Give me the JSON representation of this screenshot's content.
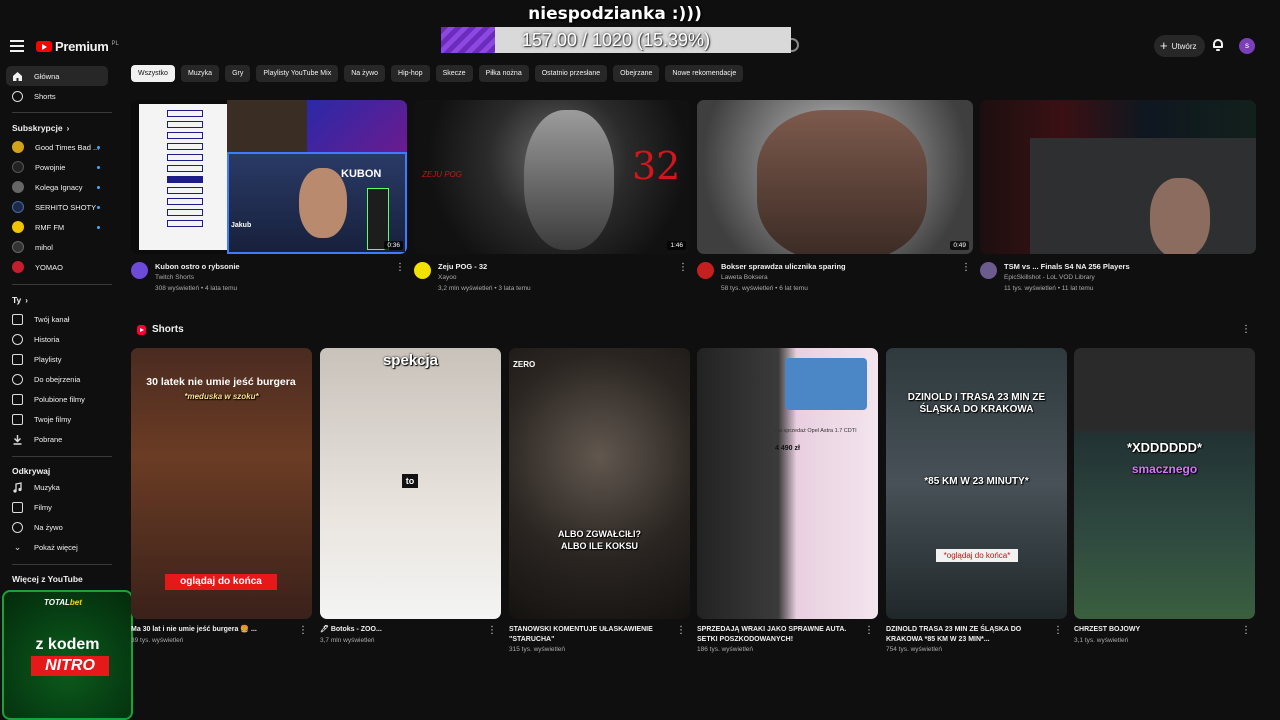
{
  "overlay": {
    "title": "niespodzianka :)))",
    "progress_text": "157.00 / 1020 (15.39%)",
    "progress_fraction": 0.1539
  },
  "header": {
    "logo_text": "Premium",
    "logo_sup": "PL",
    "create_label": "Utwórz",
    "avatar_letter": "s"
  },
  "sidebar": {
    "main": [
      {
        "label": "Główna"
      },
      {
        "label": "Shorts"
      }
    ],
    "subscriptions_heading": "Subskrypcje",
    "subscriptions": [
      {
        "label": "Good Times Bad ...",
        "color": "#d4a21a"
      },
      {
        "label": "Powojnie",
        "color": "#222222"
      },
      {
        "label": "Kolega Ignacy",
        "color": "#666666"
      },
      {
        "label": "SERHITO SHOTY",
        "color": "#1b2a4a"
      },
      {
        "label": "RMF FM",
        "color": "#f2c300"
      },
      {
        "label": "mihol",
        "color": "#333333"
      },
      {
        "label": "YOMAO",
        "color": "#c41d2c"
      }
    ],
    "you_heading": "Ty",
    "you": [
      {
        "label": "Twój kanał"
      },
      {
        "label": "Historia"
      },
      {
        "label": "Playlisty"
      },
      {
        "label": "Do obejrzenia"
      },
      {
        "label": "Polubione filmy"
      },
      {
        "label": "Twoje filmy"
      },
      {
        "label": "Pobrane"
      }
    ],
    "explore_heading": "Odkrywaj",
    "explore": [
      {
        "label": "Muzyka"
      },
      {
        "label": "Filmy"
      },
      {
        "label": "Na żywo"
      },
      {
        "label": "Pokaż więcej"
      }
    ],
    "more_heading": "Więcej z YouTube"
  },
  "ad": {
    "brand_a": "TOTAL",
    "brand_b": "bet",
    "line1": "z kodem",
    "line2": "NITRO"
  },
  "chips": [
    "Wszystko",
    "Muzyka",
    "Gry",
    "Playlisty YouTube Mix",
    "Na żywo",
    "Hip-hop",
    "Skecze",
    "Piłka nożna",
    "Ostatnio przesłane",
    "Obejrzane",
    "Nowe rekomendacje"
  ],
  "videos": [
    {
      "title": "Kubon ostro o rybsonie",
      "channel": "Twitch Shorts",
      "stats": "308 wyświetleń • 4 lata temu",
      "duration": "0:36",
      "avatar_color": "#6b4bd8",
      "thumb_texts": [
        "KUBON",
        "Jakub"
      ]
    },
    {
      "title": "Zeju POG - 32",
      "channel": "Xayoo",
      "stats": "3,2 mln wyświetleń • 3 lata temu",
      "duration": "1:46",
      "avatar_color": "#f2e200",
      "thumb_texts": [
        "32",
        "ZEJU POG"
      ]
    },
    {
      "title": "Bokser sprawdza ulicznika  sparing",
      "channel": "Laweta Boksera",
      "stats": "58 tys. wyświetleń • 6 lat temu",
      "duration": "0:49",
      "avatar_color": "#c61f1f"
    },
    {
      "title": "TSM vs ... Finals S4 NA 256 Players",
      "channel": "EpicSkillshot - LoL VOD Library",
      "stats": "11 tys. wyświetleń • 11 lat temu",
      "avatar_color": "#6b5b8f"
    }
  ],
  "shorts_heading": "Shorts",
  "shorts": [
    {
      "title": "Ma 30 lat i nie umie jeść burgera 🍔 ...",
      "stats": "39 tys. wyświetleń",
      "cap_top": "30 latek nie umie jeść burgera",
      "cap_sub": "*meduska w szoku*",
      "cap_bottom": "oglądaj do końca"
    },
    {
      "title": "🖊 Botoks - ZOO...",
      "stats": "3,7 mln wyświetleń",
      "cap_top": "spekcja",
      "cap_mid": "to"
    },
    {
      "title": "STANOWSKI KOMENTUJE UŁASKAWIENIE \"STARUCHA\"",
      "stats": "315 tys. wyświetleń",
      "cap_top": "ZERO",
      "cap_mid": "ALBO ZGWAŁCIŁI? ALBO ILE KOKSU"
    },
    {
      "title": "SPRZEDAJĄ WRAKI JAKO SPRAWNE AUTA. SETKI POSZKODOWANYCH!",
      "stats": "186 tys. wyświetleń",
      "cap_top": "Na sprzedaż Opel Astra 1.7 CDTI",
      "cap_mid": "4 490 zł"
    },
    {
      "title": "DZINOLD TRASA 23 MIN ZE ŚLĄSKA DO KRAKOWA *85 KM W 23 MIN*...",
      "stats": "754 tys. wyświetleń",
      "cap_top": "DZINOLD I TRASA 23 MIN ZE ŚLĄSKA DO KRAKOWA",
      "cap_mid": "*85 KM W 23 MINUTY*",
      "cap_bottom": "*oglądaj do końca*"
    },
    {
      "title": "CHRZEST BOJOWY",
      "stats": "3,1 tys. wyświetleń",
      "cap_top": "*XDDDDDD*",
      "cap_mid": "smacznego"
    }
  ]
}
